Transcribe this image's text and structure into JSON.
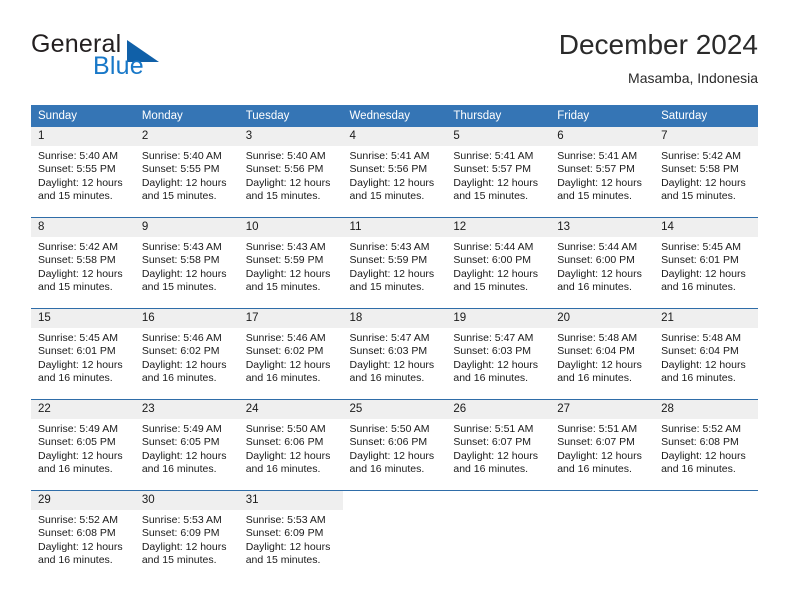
{
  "brand": {
    "name_part1": "General",
    "name_part2": "Blue",
    "triangle_icon": "triangle-icon",
    "accent_color": "#1878c8",
    "triangle_color": "#1060a8"
  },
  "header": {
    "title": "December 2024",
    "location": "Masamba, Indonesia"
  },
  "calendar": {
    "header_bg": "#3575b5",
    "daynum_bg": "#efefef",
    "grid_line_color": "#2f6da8",
    "weekday_headers": [
      "Sunday",
      "Monday",
      "Tuesday",
      "Wednesday",
      "Thursday",
      "Friday",
      "Saturday"
    ],
    "weeks": [
      [
        {
          "day": "1",
          "sunrise": "Sunrise: 5:40 AM",
          "sunset": "Sunset: 5:55 PM",
          "daylight": "Daylight: 12 hours and 15 minutes."
        },
        {
          "day": "2",
          "sunrise": "Sunrise: 5:40 AM",
          "sunset": "Sunset: 5:55 PM",
          "daylight": "Daylight: 12 hours and 15 minutes."
        },
        {
          "day": "3",
          "sunrise": "Sunrise: 5:40 AM",
          "sunset": "Sunset: 5:56 PM",
          "daylight": "Daylight: 12 hours and 15 minutes."
        },
        {
          "day": "4",
          "sunrise": "Sunrise: 5:41 AM",
          "sunset": "Sunset: 5:56 PM",
          "daylight": "Daylight: 12 hours and 15 minutes."
        },
        {
          "day": "5",
          "sunrise": "Sunrise: 5:41 AM",
          "sunset": "Sunset: 5:57 PM",
          "daylight": "Daylight: 12 hours and 15 minutes."
        },
        {
          "day": "6",
          "sunrise": "Sunrise: 5:41 AM",
          "sunset": "Sunset: 5:57 PM",
          "daylight": "Daylight: 12 hours and 15 minutes."
        },
        {
          "day": "7",
          "sunrise": "Sunrise: 5:42 AM",
          "sunset": "Sunset: 5:58 PM",
          "daylight": "Daylight: 12 hours and 15 minutes."
        }
      ],
      [
        {
          "day": "8",
          "sunrise": "Sunrise: 5:42 AM",
          "sunset": "Sunset: 5:58 PM",
          "daylight": "Daylight: 12 hours and 15 minutes."
        },
        {
          "day": "9",
          "sunrise": "Sunrise: 5:43 AM",
          "sunset": "Sunset: 5:58 PM",
          "daylight": "Daylight: 12 hours and 15 minutes."
        },
        {
          "day": "10",
          "sunrise": "Sunrise: 5:43 AM",
          "sunset": "Sunset: 5:59 PM",
          "daylight": "Daylight: 12 hours and 15 minutes."
        },
        {
          "day": "11",
          "sunrise": "Sunrise: 5:43 AM",
          "sunset": "Sunset: 5:59 PM",
          "daylight": "Daylight: 12 hours and 15 minutes."
        },
        {
          "day": "12",
          "sunrise": "Sunrise: 5:44 AM",
          "sunset": "Sunset: 6:00 PM",
          "daylight": "Daylight: 12 hours and 15 minutes."
        },
        {
          "day": "13",
          "sunrise": "Sunrise: 5:44 AM",
          "sunset": "Sunset: 6:00 PM",
          "daylight": "Daylight: 12 hours and 16 minutes."
        },
        {
          "day": "14",
          "sunrise": "Sunrise: 5:45 AM",
          "sunset": "Sunset: 6:01 PM",
          "daylight": "Daylight: 12 hours and 16 minutes."
        }
      ],
      [
        {
          "day": "15",
          "sunrise": "Sunrise: 5:45 AM",
          "sunset": "Sunset: 6:01 PM",
          "daylight": "Daylight: 12 hours and 16 minutes."
        },
        {
          "day": "16",
          "sunrise": "Sunrise: 5:46 AM",
          "sunset": "Sunset: 6:02 PM",
          "daylight": "Daylight: 12 hours and 16 minutes."
        },
        {
          "day": "17",
          "sunrise": "Sunrise: 5:46 AM",
          "sunset": "Sunset: 6:02 PM",
          "daylight": "Daylight: 12 hours and 16 minutes."
        },
        {
          "day": "18",
          "sunrise": "Sunrise: 5:47 AM",
          "sunset": "Sunset: 6:03 PM",
          "daylight": "Daylight: 12 hours and 16 minutes."
        },
        {
          "day": "19",
          "sunrise": "Sunrise: 5:47 AM",
          "sunset": "Sunset: 6:03 PM",
          "daylight": "Daylight: 12 hours and 16 minutes."
        },
        {
          "day": "20",
          "sunrise": "Sunrise: 5:48 AM",
          "sunset": "Sunset: 6:04 PM",
          "daylight": "Daylight: 12 hours and 16 minutes."
        },
        {
          "day": "21",
          "sunrise": "Sunrise: 5:48 AM",
          "sunset": "Sunset: 6:04 PM",
          "daylight": "Daylight: 12 hours and 16 minutes."
        }
      ],
      [
        {
          "day": "22",
          "sunrise": "Sunrise: 5:49 AM",
          "sunset": "Sunset: 6:05 PM",
          "daylight": "Daylight: 12 hours and 16 minutes."
        },
        {
          "day": "23",
          "sunrise": "Sunrise: 5:49 AM",
          "sunset": "Sunset: 6:05 PM",
          "daylight": "Daylight: 12 hours and 16 minutes."
        },
        {
          "day": "24",
          "sunrise": "Sunrise: 5:50 AM",
          "sunset": "Sunset: 6:06 PM",
          "daylight": "Daylight: 12 hours and 16 minutes."
        },
        {
          "day": "25",
          "sunrise": "Sunrise: 5:50 AM",
          "sunset": "Sunset: 6:06 PM",
          "daylight": "Daylight: 12 hours and 16 minutes."
        },
        {
          "day": "26",
          "sunrise": "Sunrise: 5:51 AM",
          "sunset": "Sunset: 6:07 PM",
          "daylight": "Daylight: 12 hours and 16 minutes."
        },
        {
          "day": "27",
          "sunrise": "Sunrise: 5:51 AM",
          "sunset": "Sunset: 6:07 PM",
          "daylight": "Daylight: 12 hours and 16 minutes."
        },
        {
          "day": "28",
          "sunrise": "Sunrise: 5:52 AM",
          "sunset": "Sunset: 6:08 PM",
          "daylight": "Daylight: 12 hours and 16 minutes."
        }
      ],
      [
        {
          "day": "29",
          "sunrise": "Sunrise: 5:52 AM",
          "sunset": "Sunset: 6:08 PM",
          "daylight": "Daylight: 12 hours and 16 minutes."
        },
        {
          "day": "30",
          "sunrise": "Sunrise: 5:53 AM",
          "sunset": "Sunset: 6:09 PM",
          "daylight": "Daylight: 12 hours and 15 minutes."
        },
        {
          "day": "31",
          "sunrise": "Sunrise: 5:53 AM",
          "sunset": "Sunset: 6:09 PM",
          "daylight": "Daylight: 12 hours and 15 minutes."
        },
        {
          "day": "",
          "sunrise": "",
          "sunset": "",
          "daylight": ""
        },
        {
          "day": "",
          "sunrise": "",
          "sunset": "",
          "daylight": ""
        },
        {
          "day": "",
          "sunrise": "",
          "sunset": "",
          "daylight": ""
        },
        {
          "day": "",
          "sunrise": "",
          "sunset": "",
          "daylight": ""
        }
      ]
    ]
  }
}
